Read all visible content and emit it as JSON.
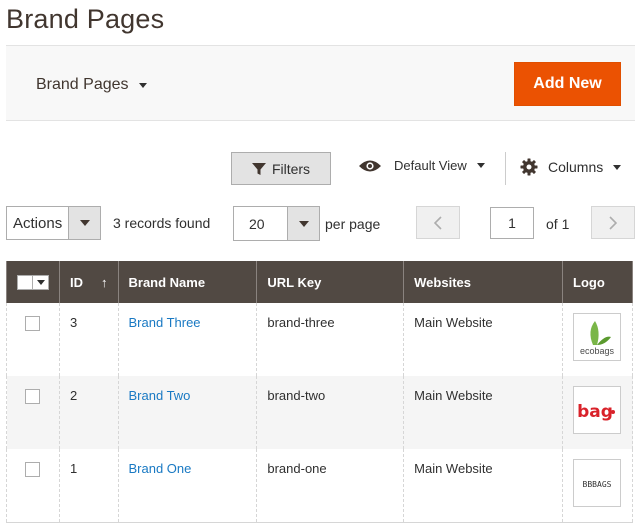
{
  "page": {
    "title": "Brand Pages"
  },
  "header": {
    "switcher_label": "Brand Pages",
    "add_new_label": "Add New",
    "accent_color": "#eb5202"
  },
  "toolbar": {
    "filters_label": "Filters",
    "view_label": "Default View",
    "columns_label": "Columns",
    "actions_label": "Actions",
    "records_found": "3 records found",
    "per_page_value": "20",
    "per_page_label": "per page",
    "current_page": "1",
    "of_pages": "of 1",
    "prev_icon": "chevron-left-icon",
    "next_icon": "chevron-right-icon"
  },
  "grid": {
    "columns": {
      "id": "ID",
      "sort_indicator": "↑",
      "brand_name": "Brand Name",
      "url_key": "URL Key",
      "websites": "Websites",
      "logo": "Logo"
    },
    "rows": [
      {
        "id": "3",
        "brand_name": "Brand Three",
        "url_key": "brand-three",
        "websites": "Main Website",
        "logo_text": "ecobags"
      },
      {
        "id": "2",
        "brand_name": "Brand Two",
        "url_key": "brand-two",
        "websites": "Main Website",
        "logo_text": "bag"
      },
      {
        "id": "1",
        "brand_name": "Brand One",
        "url_key": "brand-one",
        "websites": "Main Website",
        "logo_text": "BBBAGS"
      }
    ]
  }
}
